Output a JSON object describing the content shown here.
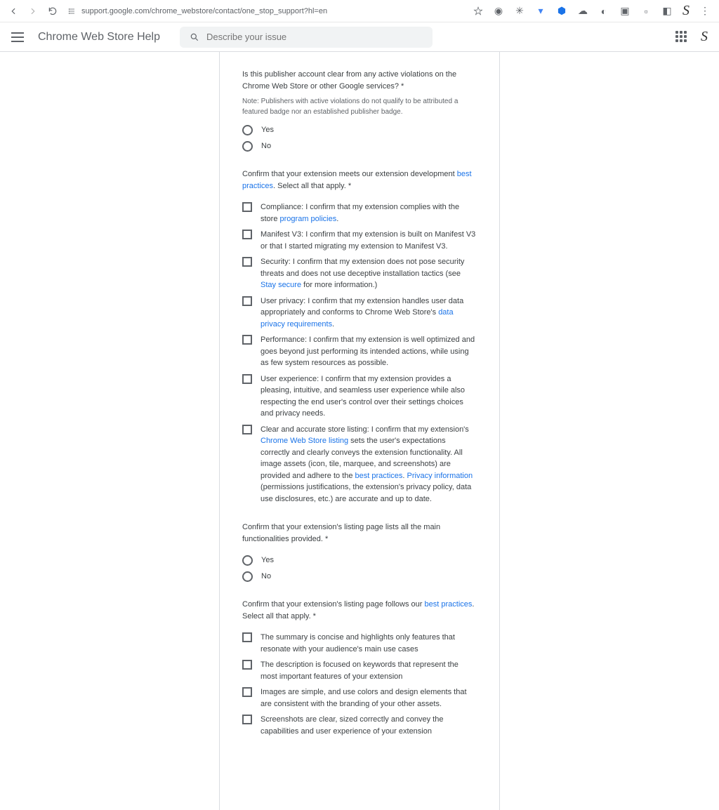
{
  "browser": {
    "url": "support.google.com/chrome_webstore/contact/one_stop_support?hl=en"
  },
  "header": {
    "title": "Chrome Web Store Help",
    "search_placeholder": "Describe your issue",
    "profile_initial": "S"
  },
  "toolbar_profile_initial": "S",
  "form": {
    "q_violations": {
      "text": "Is this publisher account clear from any active violations on the Chrome Web Store or other Google services? *",
      "note": "Note: Publishers with active violations do not qualify to be attributed a featured badge nor an established publisher badge.",
      "options": {
        "yes": "Yes",
        "no": "No"
      }
    },
    "q_best_practices": {
      "prefix": "Confirm that your extension meets our extension development ",
      "link": "best practices",
      "suffix": ". Select all that apply. *",
      "opt_compliance_prefix": "Compliance: I confirm that my extension complies with the store ",
      "opt_compliance_link": "program policies",
      "opt_compliance_suffix": ".",
      "opt_manifest": "Manifest V3: I confirm that my extension is built on Manifest V3 or that I started migrating my extension to Manifest V3.",
      "opt_security_prefix": "Security: I confirm that my extension does not pose security threats and does not use deceptive installation tactics (see ",
      "opt_security_link": "Stay secure",
      "opt_security_suffix": " for more information.)",
      "opt_privacy_prefix": "User privacy: I confirm that my extension handles user data appropriately and conforms to Chrome Web Store's ",
      "opt_privacy_link": "data privacy requirements",
      "opt_privacy_suffix": ".",
      "opt_performance": "Performance: I confirm that my extension is well optimized and goes beyond just performing its intended actions, while using as few system resources as possible.",
      "opt_ux": "User experience: I confirm that my extension provides a pleasing, intuitive, and seamless user experience while also respecting the end user's control over their settings choices and privacy needs.",
      "opt_listing_prefix": "Clear and accurate store listing: I confirm that my extension's ",
      "opt_listing_link1": "Chrome Web Store listing",
      "opt_listing_mid": " sets the user's expectations correctly and clearly conveys the extension functionality. All image assets (icon, tile, marquee, and screenshots) are provided and adhere to the ",
      "opt_listing_link2": "best practices",
      "opt_listing_sep": ". ",
      "opt_listing_link3": "Privacy information",
      "opt_listing_suffix": " (permissions justifications, the extension's privacy policy, data use disclosures, etc.) are accurate and up to date."
    },
    "q_functionalities": {
      "text": "Confirm that your extension's listing page lists all the main functionalities provided. *",
      "options": {
        "yes": "Yes",
        "no": "No"
      }
    },
    "q_listing_bp": {
      "prefix": "Confirm that your extension's listing page follows our ",
      "link": "best practices",
      "suffix": ". Select all that apply. *",
      "opt_summary": "The summary is concise and highlights only features that resonate with your audience's main use cases",
      "opt_description": "The description is focused on keywords that represent the most important features of your extension",
      "opt_images": "Images are simple, and use colors and design elements that are consistent with the branding of your other assets.",
      "opt_screenshots": "Screenshots are clear, sized correctly and convey the capabilities and user experience of your extension"
    }
  }
}
